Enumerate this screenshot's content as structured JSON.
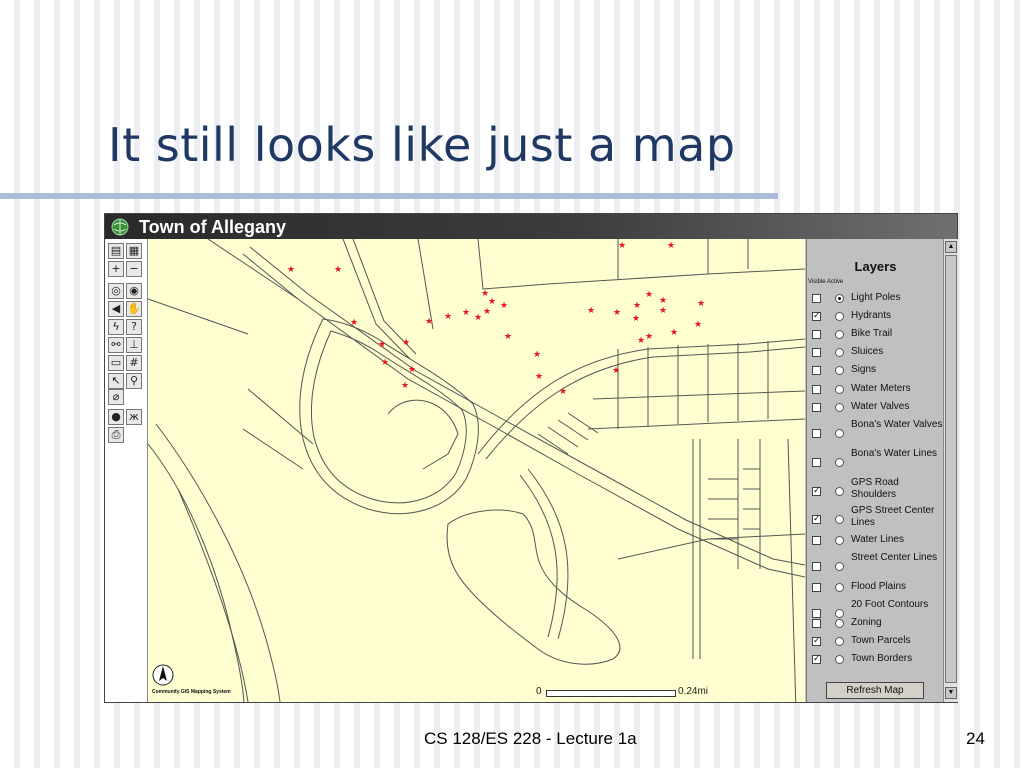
{
  "slide": {
    "title": "It still looks like just a map",
    "footer": "CS 128/ES 228 - Lecture 1a",
    "page_number": "24"
  },
  "app": {
    "title": "Town of Allegany",
    "icon": "globe-icon"
  },
  "toolbar": {
    "tools": [
      {
        "name": "toc-tool-icon",
        "glyph": "▤"
      },
      {
        "name": "legend-tool-icon",
        "glyph": "▦"
      },
      {
        "name": "zoom-in-icon",
        "glyph": "+"
      },
      {
        "name": "zoom-out-icon",
        "glyph": "−"
      },
      {
        "name": "zoom-full-icon",
        "glyph": "◎"
      },
      {
        "name": "zoom-active-icon",
        "glyph": "◉"
      },
      {
        "name": "back-icon",
        "glyph": "◀"
      },
      {
        "name": "pan-hand-icon",
        "glyph": "✋"
      },
      {
        "name": "identify-icon",
        "glyph": "ϟ"
      },
      {
        "name": "hyperlink-icon",
        "glyph": "?"
      },
      {
        "name": "find-binoculars-icon",
        "glyph": "⚯"
      },
      {
        "name": "measure-icon",
        "glyph": "⊥"
      },
      {
        "name": "select-rect-icon",
        "glyph": "▭"
      },
      {
        "name": "query-grid-icon",
        "glyph": "#"
      },
      {
        "name": "select-point-icon",
        "glyph": "↖"
      },
      {
        "name": "search-magnifier-icon",
        "glyph": "⚲"
      },
      {
        "name": "eraser-icon",
        "glyph": "⌀"
      },
      {
        "name": "stop-icon",
        "glyph": "●"
      },
      {
        "name": "buffer-icon",
        "glyph": "ж"
      },
      {
        "name": "print-icon",
        "glyph": "⎙"
      }
    ]
  },
  "map": {
    "credit": "Community GIS Mapping System",
    "scale_start": "0",
    "scale_end": "0.24mi",
    "north_label": "N"
  },
  "layers": {
    "title": "Layers",
    "column_header": "Visible Active",
    "items": [
      {
        "label": "Light Poles",
        "visible": false,
        "active": true
      },
      {
        "label": "Hydrants",
        "visible": true,
        "active": false
      },
      {
        "label": "Bike Trail",
        "visible": false,
        "active": false
      },
      {
        "label": "Sluices",
        "visible": false,
        "active": false
      },
      {
        "label": "Signs",
        "visible": false,
        "active": false
      },
      {
        "label": "Water Meters",
        "visible": false,
        "active": false
      },
      {
        "label": "Water Valves",
        "visible": false,
        "active": false
      },
      {
        "label": "Bona's Water Valves",
        "visible": false,
        "active": false
      },
      {
        "label": "Bona's Water Lines",
        "visible": false,
        "active": false
      },
      {
        "label": "GPS Road Shoulders",
        "visible": true,
        "active": false
      },
      {
        "label": "GPS Street Center Lines",
        "visible": true,
        "active": false
      },
      {
        "label": "Water Lines",
        "visible": false,
        "active": false
      },
      {
        "label": "Street Center Lines",
        "visible": false,
        "active": false
      },
      {
        "label": "Flood Plains",
        "visible": false,
        "active": false
      },
      {
        "label": "20 Foot Contours",
        "visible": false,
        "active": false
      },
      {
        "label": "Zoning",
        "visible": false,
        "active": false
      },
      {
        "label": "Town Parcels",
        "visible": true,
        "active": false
      },
      {
        "label": "Town Borders",
        "visible": true,
        "active": false
      }
    ],
    "refresh_label": "Refresh Map"
  },
  "colors": {
    "title_text": "#1f3864",
    "map_background": "#fefed0",
    "hydrant_marker": "#e8141e",
    "road_line": "#555555"
  }
}
